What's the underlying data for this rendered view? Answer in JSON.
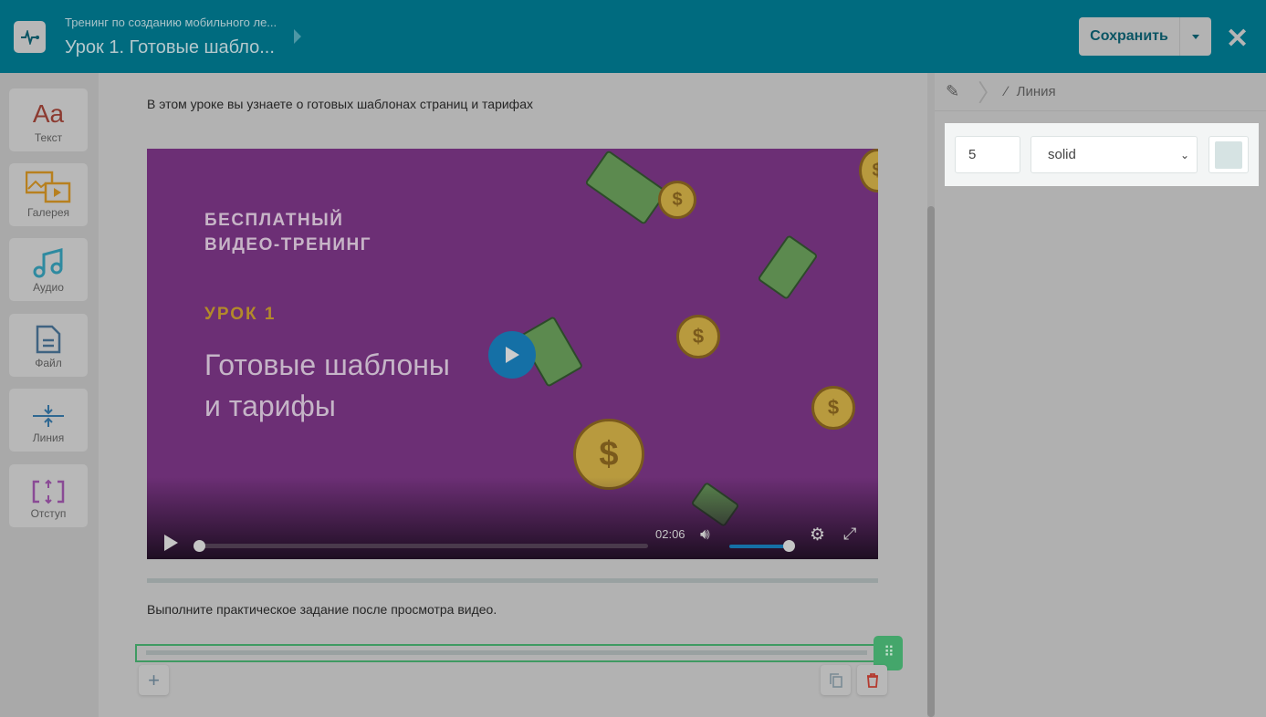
{
  "header": {
    "course": "Тренинг по созданию мобильного ле...",
    "lesson": "Урок 1. Готовые шабло...",
    "save_label": "Сохранить"
  },
  "tools": [
    {
      "label": "Текст",
      "icon": "text-icon"
    },
    {
      "label": "Галерея",
      "icon": "gallery-icon"
    },
    {
      "label": "Аудио",
      "icon": "audio-icon"
    },
    {
      "label": "Файл",
      "icon": "file-icon"
    },
    {
      "label": "Линия",
      "icon": "line-icon"
    },
    {
      "label": "Отступ",
      "icon": "spacing-icon"
    }
  ],
  "content": {
    "intro": "В этом уроке вы узнаете о готовых шаблонах страниц и тарифах",
    "video": {
      "line1": "БЕСПЛАТНЫЙ",
      "line2": "ВИДЕО-ТРЕНИНГ",
      "lesson": "УРОК 1",
      "title1": "Готовые шаблоны",
      "title2": "и тарифы",
      "time": "02:06",
      "progress": 0,
      "volume": 1.0
    },
    "task": "Выполните практическое задание после просмотра видео."
  },
  "settings": {
    "breadcrumb": "Линия",
    "width": "5",
    "style": "solid",
    "color": "#d6e3e3"
  },
  "text_icon_glyph": "Aa"
}
